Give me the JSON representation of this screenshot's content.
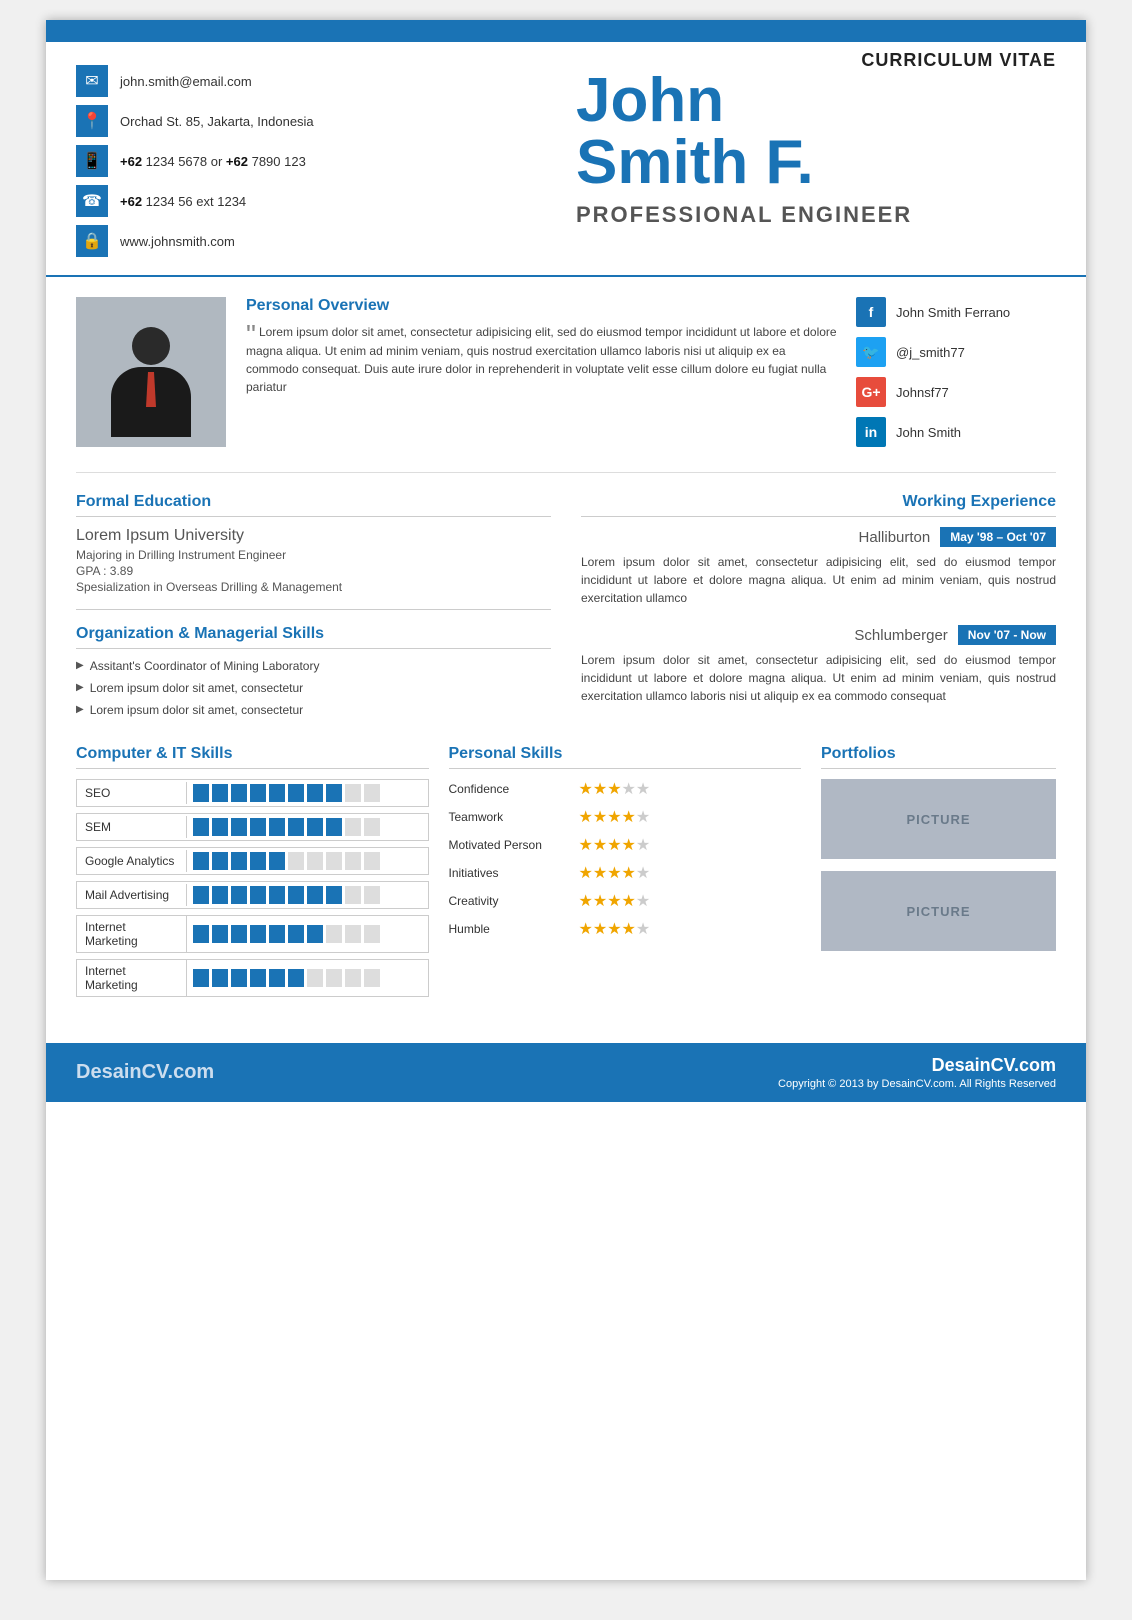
{
  "header": {
    "curriculum_vitae": "CURRICULUM VITAE",
    "name_first": "John",
    "name_last": "Smith F.",
    "profession": "PROFESSIONAL  ENGINEER"
  },
  "contact": {
    "email": "john.smith@email.com",
    "address": "Orchad St. 85, Jakarta, Indonesia",
    "phone1": "+62 1234 5678 or +62 7890 123",
    "phone1_bold1": "+62",
    "phone1_bold2": "+62",
    "phone2": "+62 1234 56 ext 1234",
    "phone2_bold": "+62",
    "website": "www.johnsmith.com"
  },
  "social": {
    "facebook": "John Smith Ferrano",
    "twitter": "@j_smith77",
    "google": "Johnsf77",
    "linkedin": "John Smith"
  },
  "personal_overview": {
    "title": "Personal Overview",
    "text": "Lorem ipsum dolor sit amet, consectetur adipisicing elit, sed do eiusmod tempor incididunt ut labore et dolore magna aliqua. Ut enim ad minim veniam, quis nostrud exercitation ullamco laboris nisi ut aliquip ex ea commodo consequat. Duis aute irure dolor in reprehenderit in voluptate velit esse cillum dolore eu fugiat nulla pariatur"
  },
  "education": {
    "title": "Formal Education",
    "university": "Lorem Ipsum University",
    "major": "Majoring in Drilling Instrument Engineer",
    "gpa": "GPA : 3.89",
    "specialization": "Spesialization in Overseas Drilling & Management"
  },
  "organization": {
    "title": "Organization & Managerial Skills",
    "items": [
      "Assitant's Coordinator of Mining Laboratory",
      "Lorem ipsum dolor sit amet, consectetur",
      "Lorem ipsum dolor sit amet, consectetur"
    ]
  },
  "work_experience": {
    "title": "Working Experience",
    "entries": [
      {
        "company": "Halliburton",
        "period": "May '98 – Oct '07",
        "description": "Lorem ipsum dolor sit amet, consectetur adipisicing elit, sed do eiusmod tempor incididunt ut labore et dolore magna aliqua. Ut enim ad minim veniam, quis nostrud exercitation ullamco"
      },
      {
        "company": "Schlumberger",
        "period": "Nov '07 - Now",
        "description": "Lorem ipsum dolor sit amet, consectetur adipisicing elit, sed do eiusmod tempor incididunt ut labore et dolore magna aliqua. Ut enim ad minim veniam, quis nostrud exercitation ullamco laboris nisi ut aliquip ex ea commodo consequat"
      }
    ]
  },
  "computer_skills": {
    "title": "Computer & IT Skills",
    "items": [
      {
        "name": "SEO",
        "filled": 8,
        "empty": 2
      },
      {
        "name": "SEM",
        "filled": 8,
        "empty": 2
      },
      {
        "name": "Google Analytics",
        "filled": 5,
        "empty": 5
      },
      {
        "name": "Mail Advertising",
        "filled": 8,
        "empty": 2
      },
      {
        "name": "Internet Marketing",
        "filled": 7,
        "empty": 3
      },
      {
        "name": "Internet Marketing",
        "filled": 6,
        "empty": 4
      }
    ]
  },
  "personal_skills": {
    "title": "Personal Skills",
    "items": [
      {
        "name": "Confidence",
        "filled": 3,
        "empty": 2
      },
      {
        "name": "Teamwork",
        "filled": 4,
        "empty": 1
      },
      {
        "name": "Motivated Person",
        "filled": 4,
        "empty": 1
      },
      {
        "name": "Initiatives",
        "filled": 4,
        "empty": 1
      },
      {
        "name": "Creativity",
        "filled": 4,
        "empty": 1
      },
      {
        "name": "Humble",
        "filled": 4,
        "empty": 1
      }
    ]
  },
  "portfolios": {
    "title": "Portfolios",
    "items": [
      "PICTURE",
      "PICTURE"
    ]
  },
  "footer": {
    "brand": "DesainCV.com",
    "copyright": "Copyright © 2013 by DesainCV.com. All Rights Reserved"
  }
}
